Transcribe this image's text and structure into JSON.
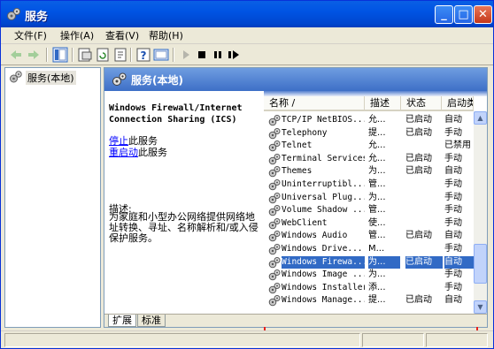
{
  "window": {
    "title": "服务"
  },
  "menu": {
    "items": [
      "文件(F)",
      "操作(A)",
      "查看(V)",
      "帮助(H)"
    ]
  },
  "tree": {
    "root_label": "服务(本地)"
  },
  "panel": {
    "header_title": "服务(本地)"
  },
  "description": {
    "service_title": "Windows Firewall/Internet Connection Sharing (ICS)",
    "stop_link": "停止",
    "stop_suffix": "此服务",
    "restart_link": "重启动",
    "restart_suffix": "此服务",
    "desc_label": "描述:",
    "desc_text": "为家庭和小型办公网络提供网络地址转换、寻址、名称解析和/或入侵保护服务。"
  },
  "list": {
    "columns": [
      "名称 /",
      "描述",
      "状态",
      "启动类"
    ],
    "rows": [
      {
        "name": "TCP/IP NetBIOS...",
        "desc": "允...",
        "status": "已启动",
        "startup": "自动"
      },
      {
        "name": "Telephony",
        "desc": "提...",
        "status": "已启动",
        "startup": "手动"
      },
      {
        "name": "Telnet",
        "desc": "允...",
        "status": "",
        "startup": "已禁用"
      },
      {
        "name": "Terminal Services",
        "desc": "允...",
        "status": "已启动",
        "startup": "手动"
      },
      {
        "name": "Themes",
        "desc": "为...",
        "status": "已启动",
        "startup": "自动"
      },
      {
        "name": "Uninterruptibl...",
        "desc": "管...",
        "status": "",
        "startup": "手动"
      },
      {
        "name": "Universal Plug...",
        "desc": "为...",
        "status": "",
        "startup": "手动"
      },
      {
        "name": "Volume Shadow ...",
        "desc": "管...",
        "status": "",
        "startup": "手动"
      },
      {
        "name": "WebClient",
        "desc": "使...",
        "status": "",
        "startup": "手动"
      },
      {
        "name": "Windows Audio",
        "desc": "管...",
        "status": "已启动",
        "startup": "自动"
      },
      {
        "name": "Windows Drive...",
        "desc": "M...",
        "status": "",
        "startup": "手动"
      },
      {
        "name": "Windows Firewa...",
        "desc": "为...",
        "status": "已启动",
        "startup": "自动"
      },
      {
        "name": "Windows Image ...",
        "desc": "为...",
        "status": "",
        "startup": "手动"
      },
      {
        "name": "Windows Installer",
        "desc": "添...",
        "status": "",
        "startup": "手动"
      },
      {
        "name": "Windows Manage...",
        "desc": "提...",
        "status": "已启动",
        "startup": "自动"
      }
    ]
  },
  "tabs": {
    "extended": "扩展",
    "standard": "标准"
  },
  "colors": {
    "title_bar": "#0054e3",
    "selection": "#316ac5",
    "highlight_box": "#e8211c",
    "link": "#0000ff"
  }
}
